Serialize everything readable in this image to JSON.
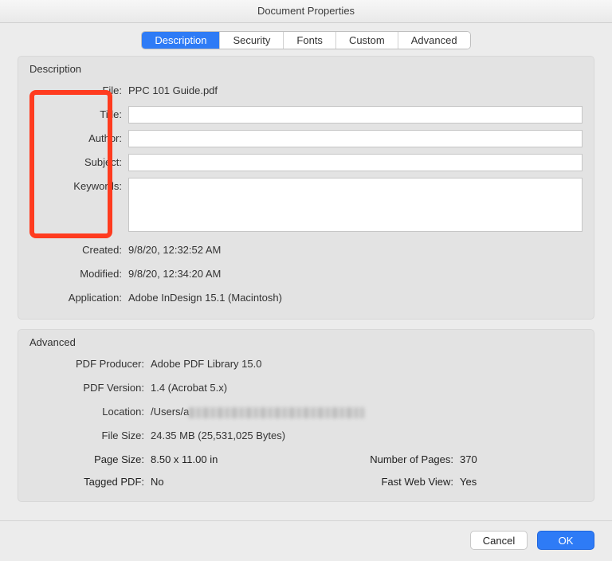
{
  "window": {
    "title": "Document Properties"
  },
  "tabs": {
    "description": "Description",
    "security": "Security",
    "fonts": "Fonts",
    "custom": "Custom",
    "advanced": "Advanced"
  },
  "descriptionSection": {
    "heading": "Description",
    "labels": {
      "file": "File:",
      "title": "Title:",
      "author": "Author:",
      "subject": "Subject:",
      "keywords": "Keywords:",
      "created": "Created:",
      "modified": "Modified:",
      "application": "Application:"
    },
    "values": {
      "file": "PPC 101 Guide.pdf",
      "title": "",
      "author": "",
      "subject": "",
      "keywords": "",
      "created": "9/8/20, 12:32:52 AM",
      "modified": "9/8/20, 12:34:20 AM",
      "application": "Adobe InDesign 15.1 (Macintosh)"
    }
  },
  "advancedSection": {
    "heading": "Advanced",
    "labels": {
      "producer": "PDF Producer:",
      "version": "PDF Version:",
      "location": "Location:",
      "fileSize": "File Size:",
      "pageSize": "Page Size:",
      "numPages": "Number of Pages:",
      "tagged": "Tagged PDF:",
      "fastWeb": "Fast Web View:"
    },
    "values": {
      "producer": "Adobe PDF Library 15.0",
      "version": "1.4 (Acrobat 5.x)",
      "locationPrefix": "/Users/a",
      "fileSize": "24.35 MB (25,531,025 Bytes)",
      "pageSize": "8.50 x 11.00 in",
      "numPages": "370",
      "tagged": "No",
      "fastWeb": "Yes"
    }
  },
  "buttons": {
    "cancel": "Cancel",
    "ok": "OK"
  }
}
